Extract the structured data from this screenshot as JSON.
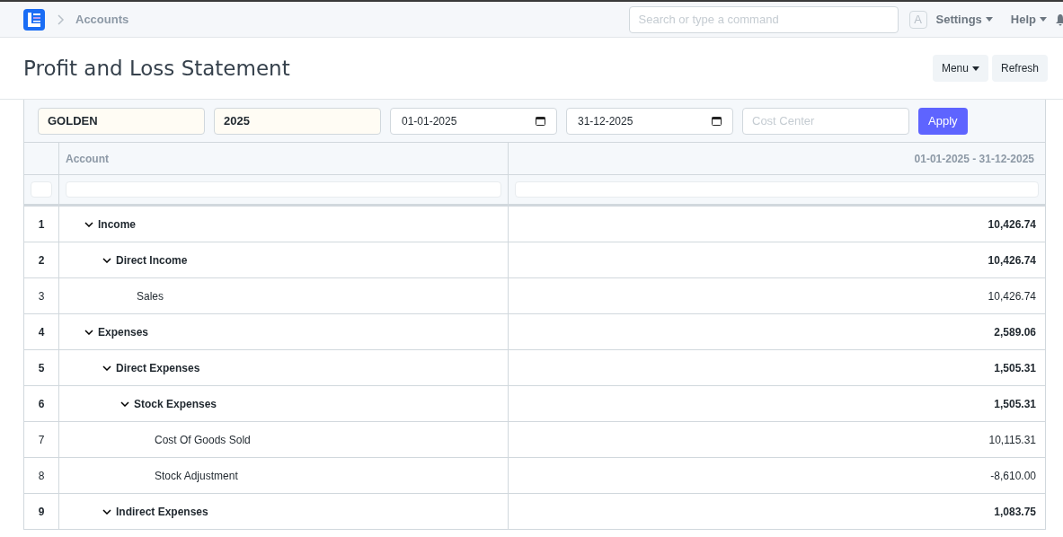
{
  "navbar": {
    "breadcrumb": "Accounts",
    "search": {
      "placeholder": "Search or type a command"
    },
    "avatar": "A",
    "menus": [
      "Settings",
      "Help"
    ]
  },
  "page": {
    "title": "Profit and Loss Statement",
    "buttons": [
      {
        "label": "Menu",
        "dropdown": true
      },
      {
        "label": "Refresh",
        "dropdown": false
      }
    ]
  },
  "filters": {
    "company": "GOLDEN",
    "fiscal_year": "2025",
    "from_date": "01-01-2025",
    "to_date": "31-12-2025",
    "cost_center": {
      "placeholder": "Cost Center"
    },
    "apply": "Apply"
  },
  "table": {
    "columns": [
      "Account",
      "01-01-2025 - 31-12-2025"
    ],
    "rows": [
      {
        "index": "1",
        "account": "Income",
        "amount": "10,426.74",
        "expanded": true,
        "children": [
          {
            "index": "2",
            "account": "Direct Income",
            "amount": "10,426.74",
            "expanded": true,
            "children": [
              {
                "index": "3",
                "account": "Sales",
                "amount": "10,426.74"
              }
            ]
          }
        ]
      },
      {
        "index": "4",
        "account": "Expenses",
        "amount": "2,589.06",
        "expanded": true,
        "children": [
          {
            "index": "5",
            "account": "Direct Expenses",
            "amount": "1,505.31",
            "expanded": true,
            "children": [
              {
                "index": "6",
                "account": "Stock Expenses",
                "amount": "1,505.31",
                "expanded": true,
                "children": [
                  {
                    "index": "7",
                    "account": "Cost Of Goods Sold",
                    "amount": "10,115.31"
                  },
                  {
                    "index": "8",
                    "account": "Stock Adjustment",
                    "amount": "-8,610.00"
                  }
                ]
              }
            ]
          },
          {
            "index": "9",
            "account": "Indirect Expenses",
            "amount": "1,083.75",
            "expanded": true
          }
        ]
      }
    ]
  }
}
